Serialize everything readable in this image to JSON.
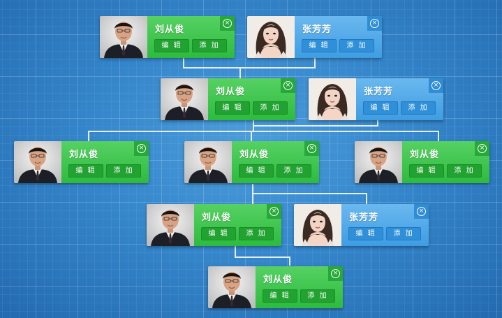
{
  "tree": {
    "nodes": [
      {
        "id": "n1",
        "variant": "green",
        "avatar": "male",
        "name": "刘从俊",
        "edit_label": "编 辑",
        "add_label": "添 加",
        "close_label": "×"
      },
      {
        "id": "n2",
        "variant": "blue",
        "avatar": "female",
        "name": "张芳芳",
        "edit_label": "编 辑",
        "add_label": "添 加",
        "close_label": "×"
      },
      {
        "id": "n3",
        "variant": "green",
        "avatar": "male",
        "name": "刘从俊",
        "edit_label": "编 辑",
        "add_label": "添 加",
        "close_label": "×"
      },
      {
        "id": "n4",
        "variant": "blue",
        "avatar": "female",
        "name": "张芳芳",
        "edit_label": "编 辑",
        "add_label": "添 加",
        "close_label": "×"
      },
      {
        "id": "n5",
        "variant": "green",
        "avatar": "male",
        "name": "刘从俊",
        "edit_label": "编 辑",
        "add_label": "添 加",
        "close_label": "×"
      },
      {
        "id": "n6",
        "variant": "green",
        "avatar": "male",
        "name": "刘从俊",
        "edit_label": "编 辑",
        "add_label": "添 加",
        "close_label": "×"
      },
      {
        "id": "n7",
        "variant": "green",
        "avatar": "male",
        "name": "刘从俊",
        "edit_label": "编 辑",
        "add_label": "添 加",
        "close_label": "×"
      },
      {
        "id": "n8",
        "variant": "green",
        "avatar": "male",
        "name": "刘从俊",
        "edit_label": "编 辑",
        "add_label": "添 加",
        "close_label": "×"
      },
      {
        "id": "n9",
        "variant": "blue",
        "avatar": "female",
        "name": "张芳芳",
        "edit_label": "编 辑",
        "add_label": "添 加",
        "close_label": "×"
      },
      {
        "id": "n10",
        "variant": "green",
        "avatar": "male",
        "name": "刘从俊",
        "edit_label": "编 辑",
        "add_label": "添 加",
        "close_label": "×"
      }
    ]
  },
  "colors": {
    "card_green": "#3cc44c",
    "card_blue": "#4aa7e8",
    "background": "#2f7fc4",
    "connector": "#e6f1fb"
  }
}
